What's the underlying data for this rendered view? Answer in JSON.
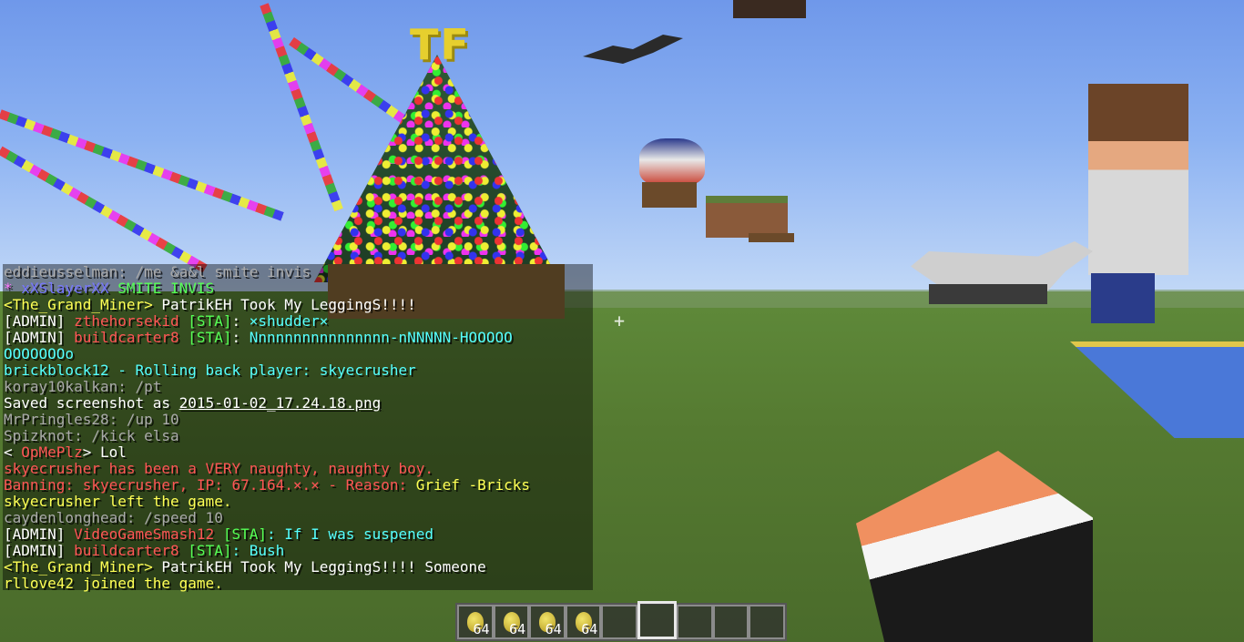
{
  "scene": {
    "tree_sign": "TF"
  },
  "chat": {
    "lines": [
      [
        {
          "t": "eddieusselman: /me &a&l smite invis",
          "c": "gray"
        }
      ],
      [
        {
          "t": "* ",
          "c": "pink"
        },
        {
          "t": "xXSlayerXX",
          "c": "blue"
        },
        {
          "t": " SMITE INVIS",
          "c": "green"
        }
      ],
      [
        {
          "t": "<The_Grand_Miner> ",
          "c": "yellow"
        },
        {
          "t": "PatrikEH Took My LeggingS!!!!",
          "c": "white"
        }
      ],
      [
        {
          "t": "[ADMIN] ",
          "c": "white"
        },
        {
          "t": "zthehorsekid ",
          "c": "red"
        },
        {
          "t": "[STA]",
          "c": "green"
        },
        {
          "t": ": ",
          "c": "white"
        },
        {
          "t": "×shudder×",
          "c": "aqua"
        }
      ],
      [
        {
          "t": "[ADMIN] ",
          "c": "white"
        },
        {
          "t": "buildcarter8 ",
          "c": "red"
        },
        {
          "t": "[STA]",
          "c": "green"
        },
        {
          "t": ": ",
          "c": "white"
        },
        {
          "t": "Nnnnnnnnnnnnnnnn-nNNNNN-HOOOOO",
          "c": "aqua"
        }
      ],
      [
        {
          "t": "OOOOOOOo",
          "c": "aqua"
        }
      ],
      [
        {
          "t": "brickblock12 - Rolling back player: skyecrusher",
          "c": "aqua"
        }
      ],
      [
        {
          "t": "koray10kalkan: /pt",
          "c": "gray"
        }
      ],
      [
        {
          "t": "Saved screenshot as ",
          "c": "white"
        },
        {
          "t": "2015-01-02_17.24.18.png",
          "c": "white",
          "u": true
        }
      ],
      [
        {
          "t": "MrPringles28: /up 10",
          "c": "gray"
        }
      ],
      [
        {
          "t": "Spizknot: /kick elsa",
          "c": "gray"
        }
      ],
      [
        {
          "t": "< ",
          "c": "white"
        },
        {
          "t": "OpMePlz",
          "c": "red"
        },
        {
          "t": "> Lol",
          "c": "white"
        }
      ],
      [
        {
          "t": "skyecrusher has been a VERY naughty, naughty boy.",
          "c": "red"
        }
      ],
      [
        {
          "t": "Banning: skyecrusher, IP: 67.164.×.× - Reason: ",
          "c": "red"
        },
        {
          "t": "Grief -Bricks",
          "c": "yellow"
        }
      ],
      [
        {
          "t": "skyecrusher left the game.",
          "c": "yellow"
        }
      ],
      [
        {
          "t": "caydenlonghead: /speed 10",
          "c": "gray"
        }
      ],
      [
        {
          "t": "[ADMIN] ",
          "c": "white"
        },
        {
          "t": "VideoGameSmash12 ",
          "c": "red"
        },
        {
          "t": "[STA]",
          "c": "green"
        },
        {
          "t": ": If I was suspened",
          "c": "aqua"
        }
      ],
      [
        {
          "t": "[ADMIN] ",
          "c": "white"
        },
        {
          "t": "buildcarter8 ",
          "c": "red"
        },
        {
          "t": "[STA]",
          "c": "green"
        },
        {
          "t": ": Bush",
          "c": "aqua"
        }
      ],
      [
        {
          "t": "<The_Grand_Miner> ",
          "c": "yellow"
        },
        {
          "t": "PatrikEH Took My LeggingS!!!! Someone",
          "c": "white"
        }
      ],
      [
        {
          "t": "rllove42 joined the game.",
          "c": "yellow"
        }
      ]
    ]
  },
  "hotbar": {
    "selected_index": 5,
    "slots": [
      {
        "item": "egg-icon",
        "count": "64"
      },
      {
        "item": "egg-icon",
        "count": "64"
      },
      {
        "item": "egg-icon",
        "count": "64"
      },
      {
        "item": "egg-icon",
        "count": "64"
      },
      {
        "item": "",
        "count": ""
      },
      {
        "item": "",
        "count": ""
      },
      {
        "item": "",
        "count": ""
      },
      {
        "item": "",
        "count": ""
      },
      {
        "item": "",
        "count": ""
      }
    ]
  }
}
